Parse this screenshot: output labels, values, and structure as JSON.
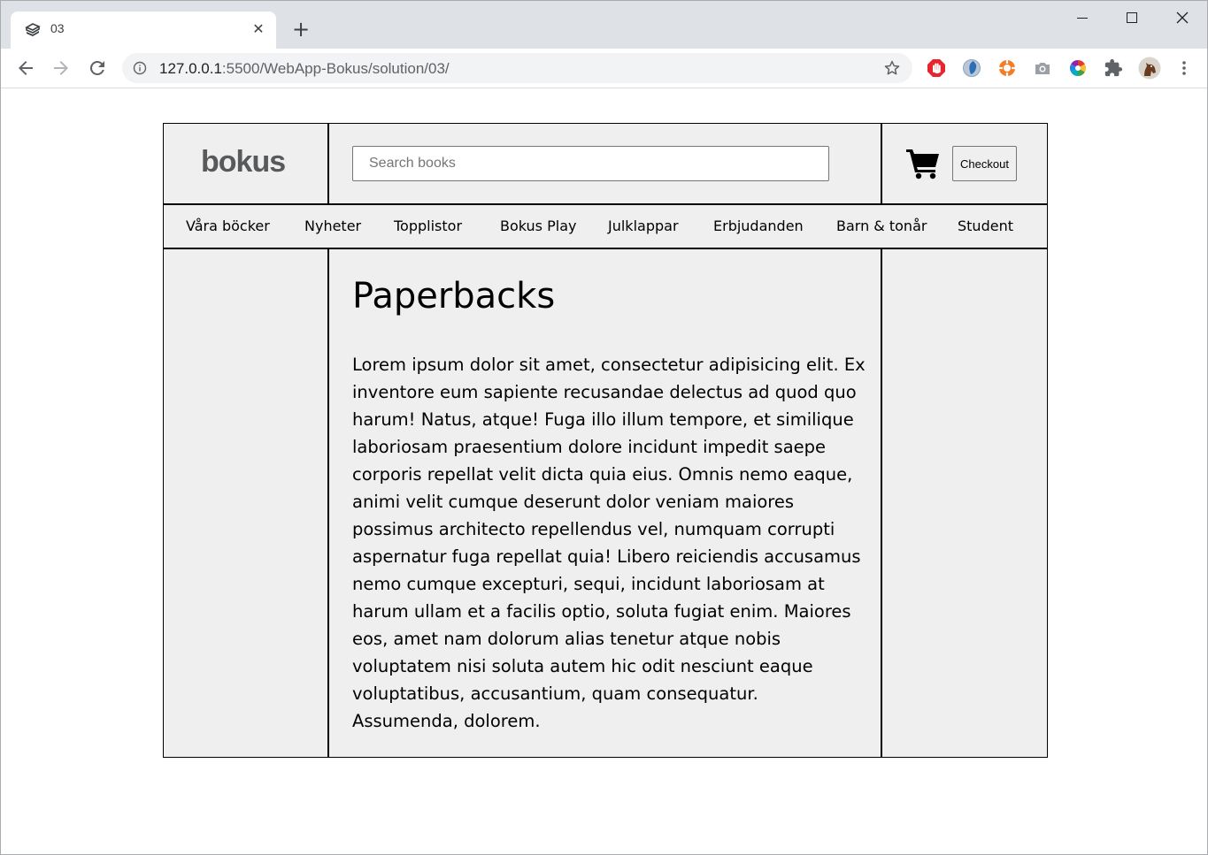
{
  "browser": {
    "tab_title": "03",
    "tab_close": "✕",
    "new_tab": "+",
    "url_host": "127.0.0.1",
    "url_path": ":5500/WebApp-Bokus/solution/03/"
  },
  "header": {
    "logo_text": "bokus",
    "search_placeholder": "Search books",
    "checkout_label": "Checkout"
  },
  "nav": {
    "items": [
      "Våra böcker",
      "Nyheter",
      "Topplistor",
      "Bokus Play",
      "Julklappar",
      "Erbjudanden",
      "Barn & tonår",
      "Student"
    ]
  },
  "main": {
    "title": "Paperbacks",
    "body": "Lorem ipsum dolor sit amet, consectetur adipisicing elit. Ex inventore eum sapiente recusandae delectus ad quod quo harum! Natus, atque! Fuga illo illum tempore, et similique laboriosam praesentium dolore incidunt impedit saepe corporis repellat velit dicta quia eius. Omnis nemo eaque, animi velit cumque deserunt dolor veniam maiores possimus architecto repellendus vel, numquam corrupti aspernatur fuga repellat quia! Libero reiciendis accusamus nemo cumque excepturi, sequi, incidunt laboriosam at harum ullam et a facilis optio, soluta fugiat enim. Maiores eos, amet nam dolorum alias tenetur atque nobis voluptatem nisi soluta autem hic odit nesciunt eaque voluptatibus, accusantium, quam consequatur. Assumenda, dolorem."
  },
  "icons": {
    "tab_favicon": "book-stack-icon",
    "back": "arrow-left-icon",
    "forward": "arrow-right-icon",
    "reload": "reload-icon",
    "info": "info-icon",
    "bookmark": "star-icon",
    "extensions": [
      "stop-hand-extension-icon",
      "blue-sphere-extension-icon",
      "lifebuoy-extension-icon",
      "camera-extension-icon",
      "color-wheel-extension-icon",
      "puzzle-icon",
      "profile-avatar"
    ],
    "menu": "more-vert-icon",
    "cart": "shopping-cart-icon"
  }
}
